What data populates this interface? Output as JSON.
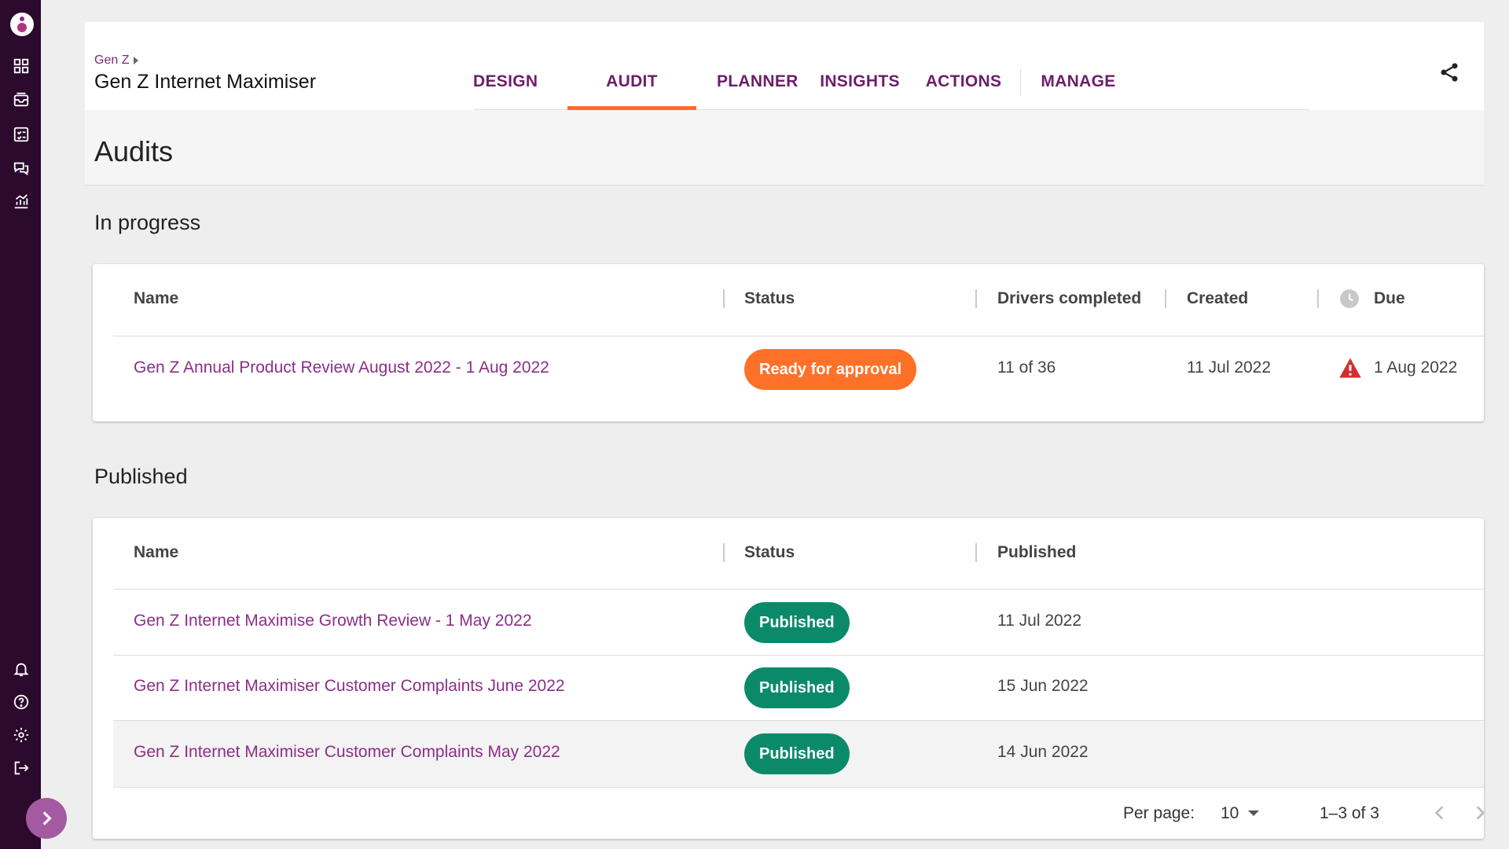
{
  "colors": {
    "sidebar": "#2b0a2e",
    "accent": "#ff6b2f",
    "link": "#8c2e89",
    "published_badge": "#0b8a6a",
    "ready_badge": "#ff7128"
  },
  "sidebar": {
    "top_icons": [
      "dashboard-icon",
      "inbox-icon",
      "checklist-icon",
      "chat-icon",
      "analytics-icon"
    ],
    "bottom_icons": [
      "bell-icon",
      "help-icon",
      "settings-icon",
      "logout-icon"
    ]
  },
  "header": {
    "breadcrumb": "Gen Z",
    "title": "Gen Z Internet Maximiser",
    "tabs": [
      {
        "label": "DESIGN"
      },
      {
        "label": "AUDIT"
      },
      {
        "label": "PLANNER"
      },
      {
        "label": "INSIGHTS"
      },
      {
        "label": "ACTIONS"
      },
      {
        "label": "MANAGE"
      }
    ],
    "active_tab": "AUDIT"
  },
  "page": {
    "title": "Audits"
  },
  "in_progress": {
    "title": "In progress",
    "columns": [
      "Name",
      "Status",
      "Drivers completed",
      "Created",
      "Due"
    ],
    "rows": [
      {
        "name": "Gen Z Annual Product Review August 2022 - 1 Aug 2022",
        "status": "Ready for approval",
        "drivers": "11 of 36",
        "created": "11 Jul 2022",
        "due": "1 Aug 2022"
      }
    ]
  },
  "published": {
    "title": "Published",
    "columns": [
      "Name",
      "Status",
      "Published"
    ],
    "rows": [
      {
        "name": "Gen Z Internet Maximise Growth Review - 1 May 2022",
        "status": "Published",
        "published": "11 Jul 2022"
      },
      {
        "name": "Gen Z Internet Maximiser Customer Complaints June 2022",
        "status": "Published",
        "published": "15 Jun 2022"
      },
      {
        "name": "Gen Z Internet Maximiser Customer Complaints May 2022",
        "status": "Published",
        "published": "14 Jun 2022"
      }
    ],
    "pagination": {
      "per_page_label": "Per page:",
      "per_page_value": "10",
      "range": "1–3 of 3"
    }
  }
}
